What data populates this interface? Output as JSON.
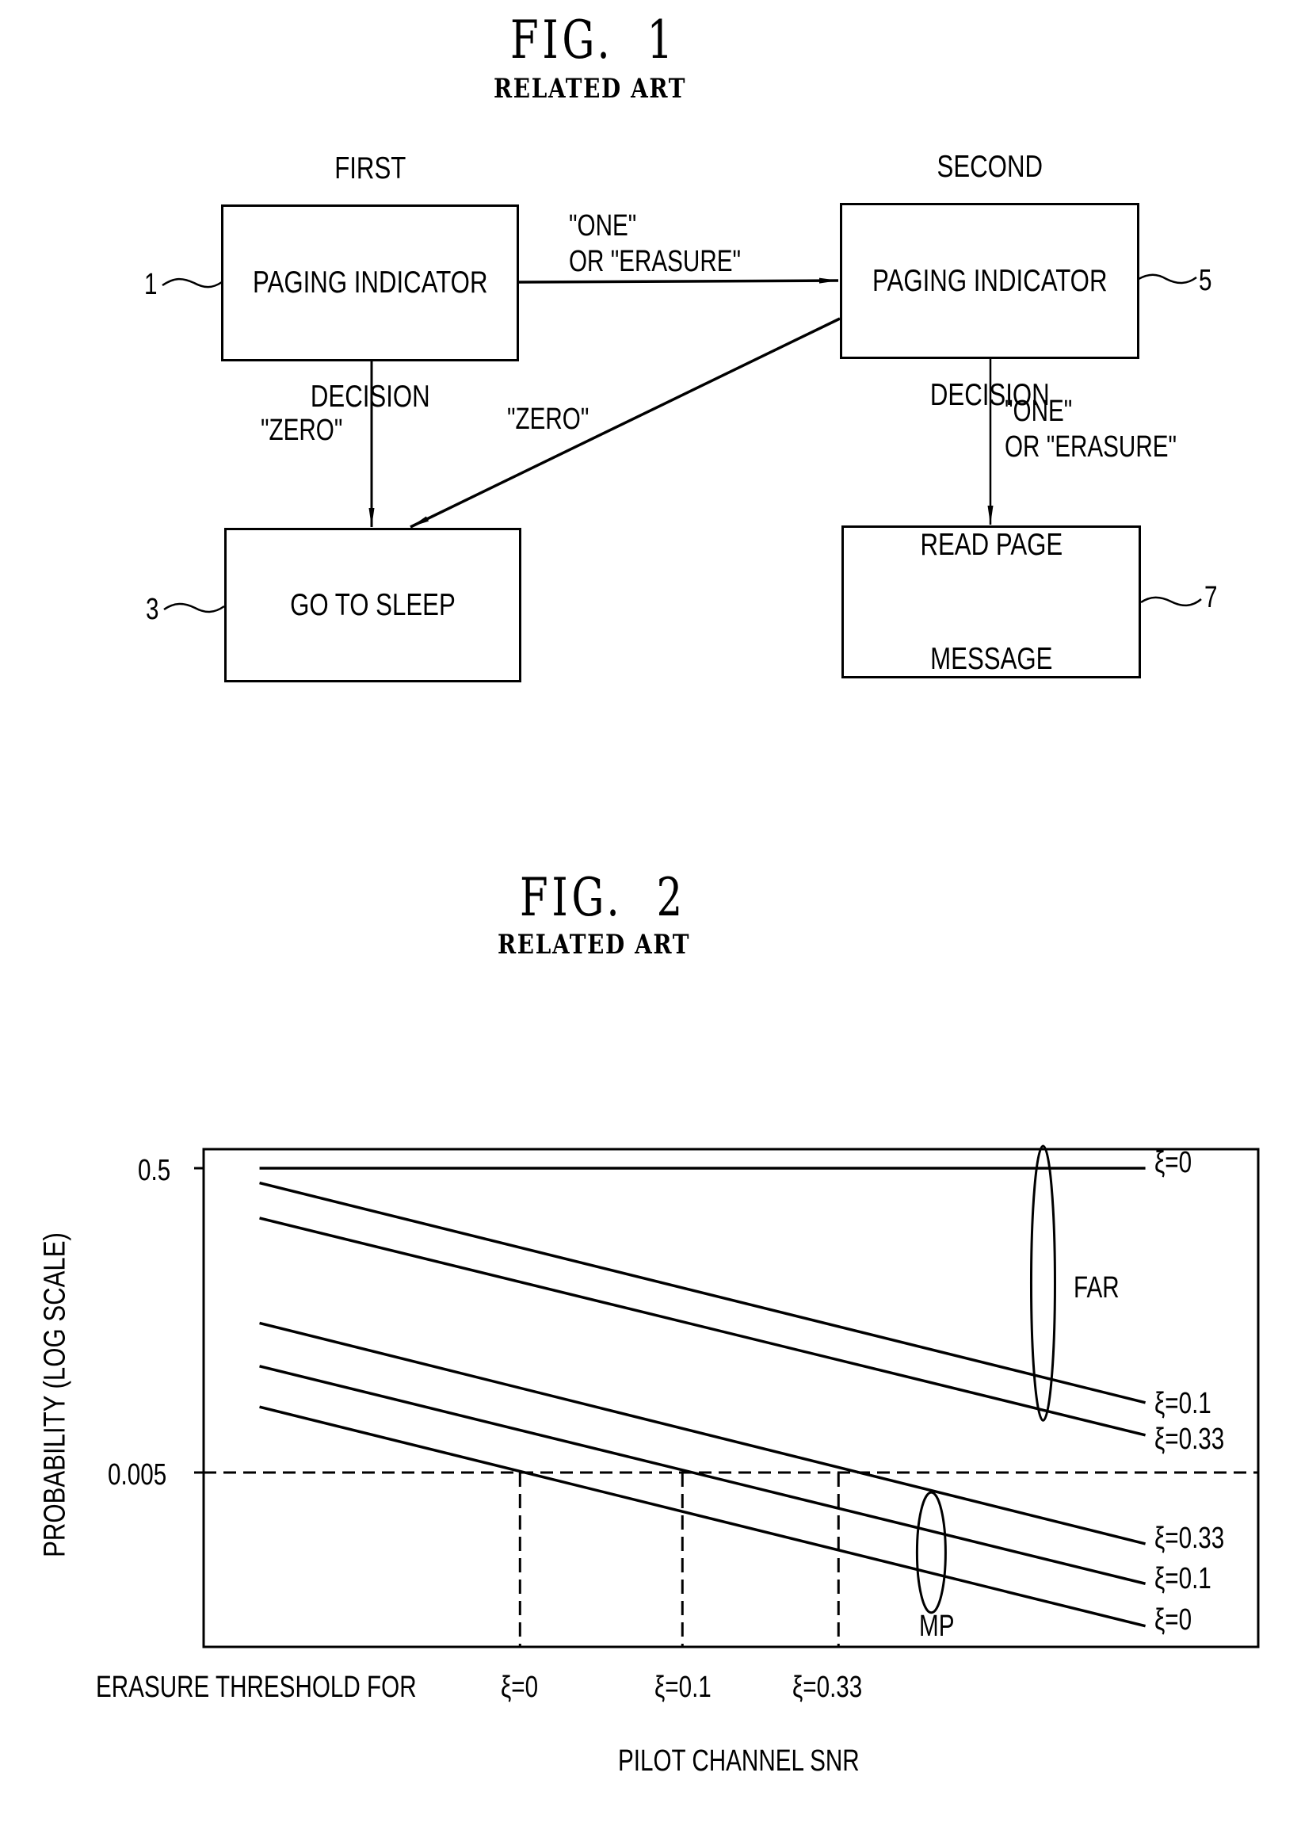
{
  "fig1": {
    "title": "FIG.  1",
    "subtitle": "RELATED ART",
    "nodes": [
      {
        "id": "1",
        "ref": "1",
        "lines": [
          "FIRST",
          "PAGING INDICATOR",
          "DECISION"
        ]
      },
      {
        "id": "3",
        "ref": "3",
        "lines": [
          "GO TO SLEEP"
        ]
      },
      {
        "id": "5",
        "ref": "5",
        "lines": [
          "SECOND",
          "PAGING INDICATOR",
          "DECISION"
        ]
      },
      {
        "id": "7",
        "ref": "7",
        "lines": [
          "READ PAGE",
          "MESSAGE"
        ]
      }
    ],
    "edges": [
      {
        "from": "1",
        "to": "5",
        "label_lines": [
          "\"ONE\"",
          "OR \"ERASURE\""
        ]
      },
      {
        "from": "1",
        "to": "3",
        "label_lines": [
          "\"ZERO\""
        ]
      },
      {
        "from": "5",
        "to": "3",
        "label_lines": [
          "\"ZERO\""
        ]
      },
      {
        "from": "5",
        "to": "7",
        "label_lines": [
          "\"ONE\"",
          "OR \"ERASURE\""
        ]
      }
    ]
  },
  "fig2": {
    "title": "FIG.  2",
    "subtitle": "RELATED ART"
  },
  "chart_data": {
    "type": "line",
    "title": "FIG. 2 RELATED ART",
    "xlabel": "PILOT CHANNEL SNR",
    "ylabel": "PROBABILITY (LOG SCALE)",
    "yscale": "log",
    "y_ticks": [
      0.5,
      0.005
    ],
    "y_tick_labels": [
      "0.5",
      "0.005"
    ],
    "ylim": [
      0.0003,
      0.7
    ],
    "x_units": "relative (no numeric ticks)",
    "xlim": [
      0,
      1
    ],
    "grid": false,
    "series": [
      {
        "group": "FAR",
        "name": "ξ=0",
        "label": "ξ=0",
        "x": [
          0.053,
          0.893
        ],
        "y": [
          0.5,
          0.5
        ],
        "line_end": 0.893
      },
      {
        "group": "FAR",
        "name": "ξ=0.1",
        "label": "ξ=0.1",
        "x": [
          0.053,
          0.893
        ],
        "y": [
          0.4,
          0.0144
        ]
      },
      {
        "group": "FAR",
        "name": "ξ=0.33",
        "label": "ξ=0.33",
        "x": [
          0.053,
          0.893
        ],
        "y": [
          0.235,
          0.0088
        ]
      },
      {
        "group": "MP",
        "name": "ξ=0.33",
        "label": "ξ=0.33",
        "x": [
          0.053,
          0.893
        ],
        "y": [
          0.048,
          0.0017
        ]
      },
      {
        "group": "MP",
        "name": "ξ=0.1",
        "label": "ξ=0.1",
        "x": [
          0.053,
          0.893
        ],
        "y": [
          0.025,
          0.00093
        ]
      },
      {
        "group": "MP",
        "name": "ξ=0",
        "label": "ξ=0",
        "x": [
          0.053,
          0.893
        ],
        "y": [
          0.0135,
          0.00049
        ]
      }
    ],
    "reference_line": {
      "y": 0.005,
      "style": "dashed"
    },
    "thresholds": [
      {
        "label": "ξ=0",
        "x": 0.3,
        "prefix": "ERASURE THRESHOLD FOR"
      },
      {
        "label": "ξ=0.1",
        "x": 0.454,
        "prefix": ""
      },
      {
        "label": "ξ=0.33",
        "x": 0.602,
        "prefix": ""
      }
    ],
    "annotations": [
      {
        "text": "FAR",
        "type": "ellipse",
        "x": 0.796,
        "y_range": [
          0.011,
          0.7
        ]
      },
      {
        "text": "MP",
        "type": "ellipse",
        "x": 0.69,
        "y_range": [
          0.0006,
          0.0037
        ]
      }
    ]
  }
}
